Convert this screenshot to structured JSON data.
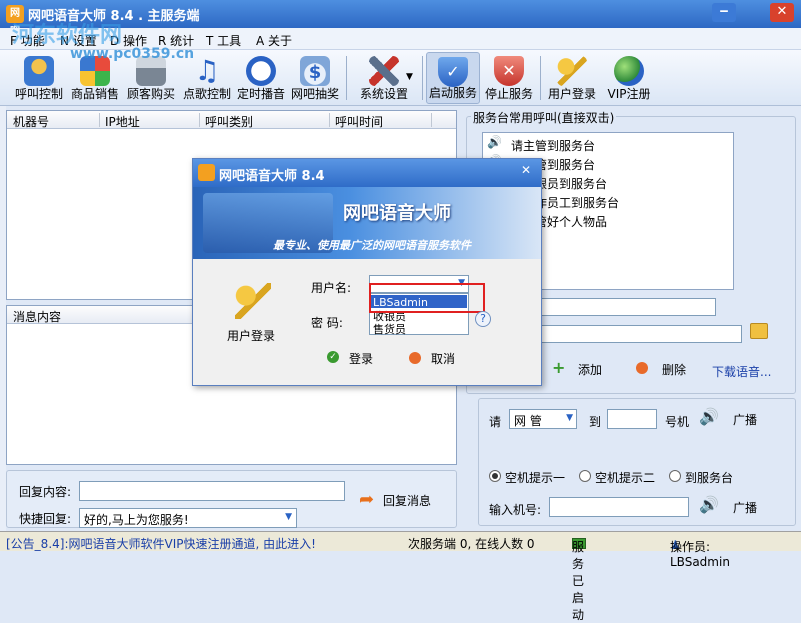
{
  "window": {
    "title": "网吧语音大师  8.4  . 主服务端",
    "logo_text": "网吧",
    "watermark_text": "河东软件网",
    "watermark_url": "www.pc0359.cn"
  },
  "menu": [
    "F 功能",
    "N 设置",
    "D 操作",
    "R 统计",
    "T 工具",
    "A 关于"
  ],
  "toolbar": {
    "buttons": [
      {
        "label": "呼叫控制",
        "icon": "people-icon"
      },
      {
        "label": "商品销售",
        "icon": "puzzle-icon"
      },
      {
        "label": "顾客购买",
        "icon": "register-icon"
      },
      {
        "label": "点歌控制",
        "icon": "music-note-icon"
      },
      {
        "label": "定时播音",
        "icon": "clock-icon"
      },
      {
        "label": "网吧抽奖",
        "icon": "money-bag-icon"
      },
      {
        "label": "系统设置",
        "icon": "tools-icon"
      },
      {
        "label": "启动服务",
        "icon": "shield-check-icon"
      },
      {
        "label": "停止服务",
        "icon": "shield-stop-icon"
      },
      {
        "label": "用户登录",
        "icon": "key-icon"
      },
      {
        "label": "VIP注册",
        "icon": "globe-icon"
      }
    ]
  },
  "call_table": {
    "columns": [
      "机器号",
      "IP地址",
      "呼叫类别",
      "呼叫时间"
    ]
  },
  "messages": {
    "header": "消息内容"
  },
  "reply": {
    "reply_label": "回复内容:",
    "quick_label": "快捷回复:",
    "quick_value": "好的,马上为您服务!",
    "send_label": "回复消息"
  },
  "common_calls": {
    "title": "服务台常用呼叫(直接双击)",
    "items": [
      "请主管到服务台",
      "请主管到服务台",
      "请收银员到服务台",
      "请工作员工到服务台",
      "请保管好个人物品"
    ],
    "add_label": "添加",
    "delete_label": "删除",
    "download_label": "下载语音..."
  },
  "broadcast": {
    "please_label": "请",
    "role_value": "网 管",
    "to_label": "到",
    "machine_label": "号机",
    "broadcast_label": "广播",
    "radios": [
      "空机提示一",
      "空机提示二",
      "到服务台"
    ],
    "input_label": "输入机号:",
    "broadcast_label2": "广播"
  },
  "status": {
    "notice": "[公告_8.4]:网吧语音大师软件VIP快速注册通道, 由此进入!",
    "stats": "次服务端 0, 在线人数 0",
    "service_state": "服务已启动",
    "operator": "操作员: LBSadmin"
  },
  "login_dialog": {
    "title": "网吧语音大师  8.4",
    "banner_title": "网吧语音大师",
    "banner_slogan": "最专业、使用最广泛的网吧语音服务软件",
    "key_label": "用户登录",
    "username_label": "用户名:",
    "password_label": "密  码:",
    "dropdown_options": [
      "LBSadmin",
      "收银员",
      "售货员"
    ],
    "login_label": "登录",
    "cancel_label": "取消"
  },
  "colors": {
    "accent": "#2d68c4",
    "highlight": "#3064c8",
    "red_box": "#e02020"
  }
}
